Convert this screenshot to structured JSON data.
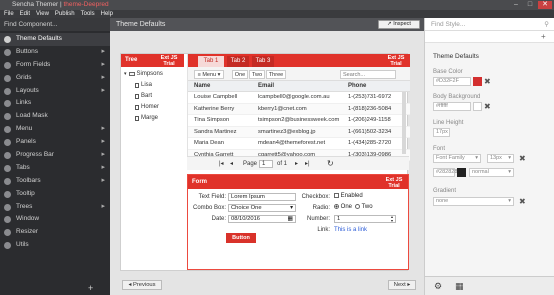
{
  "window": {
    "title_prefix": "Sencha Themer",
    "title_separator": " | ",
    "title_theme": "theme-Deepred",
    "controls": [
      "–",
      "□",
      "✕"
    ]
  },
  "menu": [
    "File",
    "Edit",
    "View",
    "Publish",
    "Tools",
    "Help"
  ],
  "sidebar": {
    "search_placeholder": "Find Component...",
    "items": [
      {
        "label": "Theme Defaults",
        "has_children": false,
        "active": true
      },
      {
        "label": "Buttons",
        "has_children": true
      },
      {
        "label": "Form Fields",
        "has_children": true
      },
      {
        "label": "Grids",
        "has_children": true
      },
      {
        "label": "Layouts",
        "has_children": true
      },
      {
        "label": "Links",
        "has_children": false
      },
      {
        "label": "Load Mask",
        "has_children": false
      },
      {
        "label": "Menu",
        "has_children": true
      },
      {
        "label": "Panels",
        "has_children": true
      },
      {
        "label": "Progress Bar",
        "has_children": true
      },
      {
        "label": "Tabs",
        "has_children": true
      },
      {
        "label": "Toolbars",
        "has_children": true
      },
      {
        "label": "Tooltip",
        "has_children": false
      },
      {
        "label": "Trees",
        "has_children": true
      },
      {
        "label": "Window",
        "has_children": false
      },
      {
        "label": "Resizer",
        "has_children": false
      },
      {
        "label": "Utils",
        "has_children": false
      }
    ],
    "add_label": "+"
  },
  "main": {
    "header": "Theme Defaults",
    "inspect_label": "Inspect",
    "prev_label": "Previous",
    "next_label": "Next",
    "ribbon": "Ext JS Trial",
    "tree": {
      "title": "Tree",
      "root": "Simpsons",
      "children": [
        "Lisa",
        "Bart",
        "Homer",
        "Marge"
      ]
    },
    "tabs": [
      "Tab 1",
      "Tab 2",
      "Tab 3"
    ],
    "toolbar": {
      "menu_label": "Menu",
      "buttons": [
        "One",
        "Two",
        "Three"
      ],
      "search_placeholder": "Search..."
    },
    "grid": {
      "columns": [
        "Name",
        "Email",
        "Phone"
      ],
      "rows": [
        [
          "Louise Campbell",
          "lcampbell0@google.com.au",
          "1-(253)731-6972"
        ],
        [
          "Katherine Berry",
          "kberry1@cnet.com",
          "1-(818)236-5084"
        ],
        [
          "Tina Simpson",
          "tsimpson2@businessweek.com",
          "1-(206)249-1158"
        ],
        [
          "Sandra Martinez",
          "smartinez3@exblog.jp",
          "1-(661)502-3234"
        ],
        [
          "Maria Dean",
          "mdean4@themeforest.net",
          "1-(434)285-2720"
        ],
        [
          "Cynthia Garrett",
          "cgarrett5@yahoo.com",
          "1-(303)139-0986"
        ]
      ]
    },
    "pager": {
      "page_label": "Page",
      "page_value": "1",
      "of_label": "of 1"
    },
    "form": {
      "title": "Form",
      "text_field_label": "Text Field:",
      "text_field_value": "Lorem Ipsum",
      "combo_label": "Combo Box:",
      "combo_value": "Choice One",
      "date_label": "Date:",
      "date_value": "08/10/2016",
      "checkbox_label": "Checkbox:",
      "checkbox_text": "Enabled",
      "radio_label": "Radio:",
      "radio_one": "One",
      "radio_two": "Two",
      "number_label": "Number:",
      "number_value": "1",
      "link_label": "Link:",
      "link_text": "This is a link",
      "button_label": "Button"
    }
  },
  "right": {
    "search_placeholder": "Find Style...",
    "section_title": "Theme Defaults",
    "base_color_label": "Base Color",
    "base_color_value": "#D32F2F",
    "base_color_swatch": "#d32f2f",
    "body_bg_label": "Body Background",
    "body_bg_value": "#ffffff",
    "line_height_label": "Line Height",
    "line_height_value": "17px",
    "font_label": "Font",
    "font_family_placeholder": "Font Family",
    "font_size_value": "13px",
    "font_color_value": "#282828",
    "font_color_swatch": "#222222",
    "font_weight_value": "normal",
    "gradient_label": "Gradient",
    "gradient_value": "none"
  },
  "colors": {
    "accent": "#e0322a",
    "sidebar_bg": "#2b2c2f",
    "main_bg": "#e4e4e4"
  }
}
